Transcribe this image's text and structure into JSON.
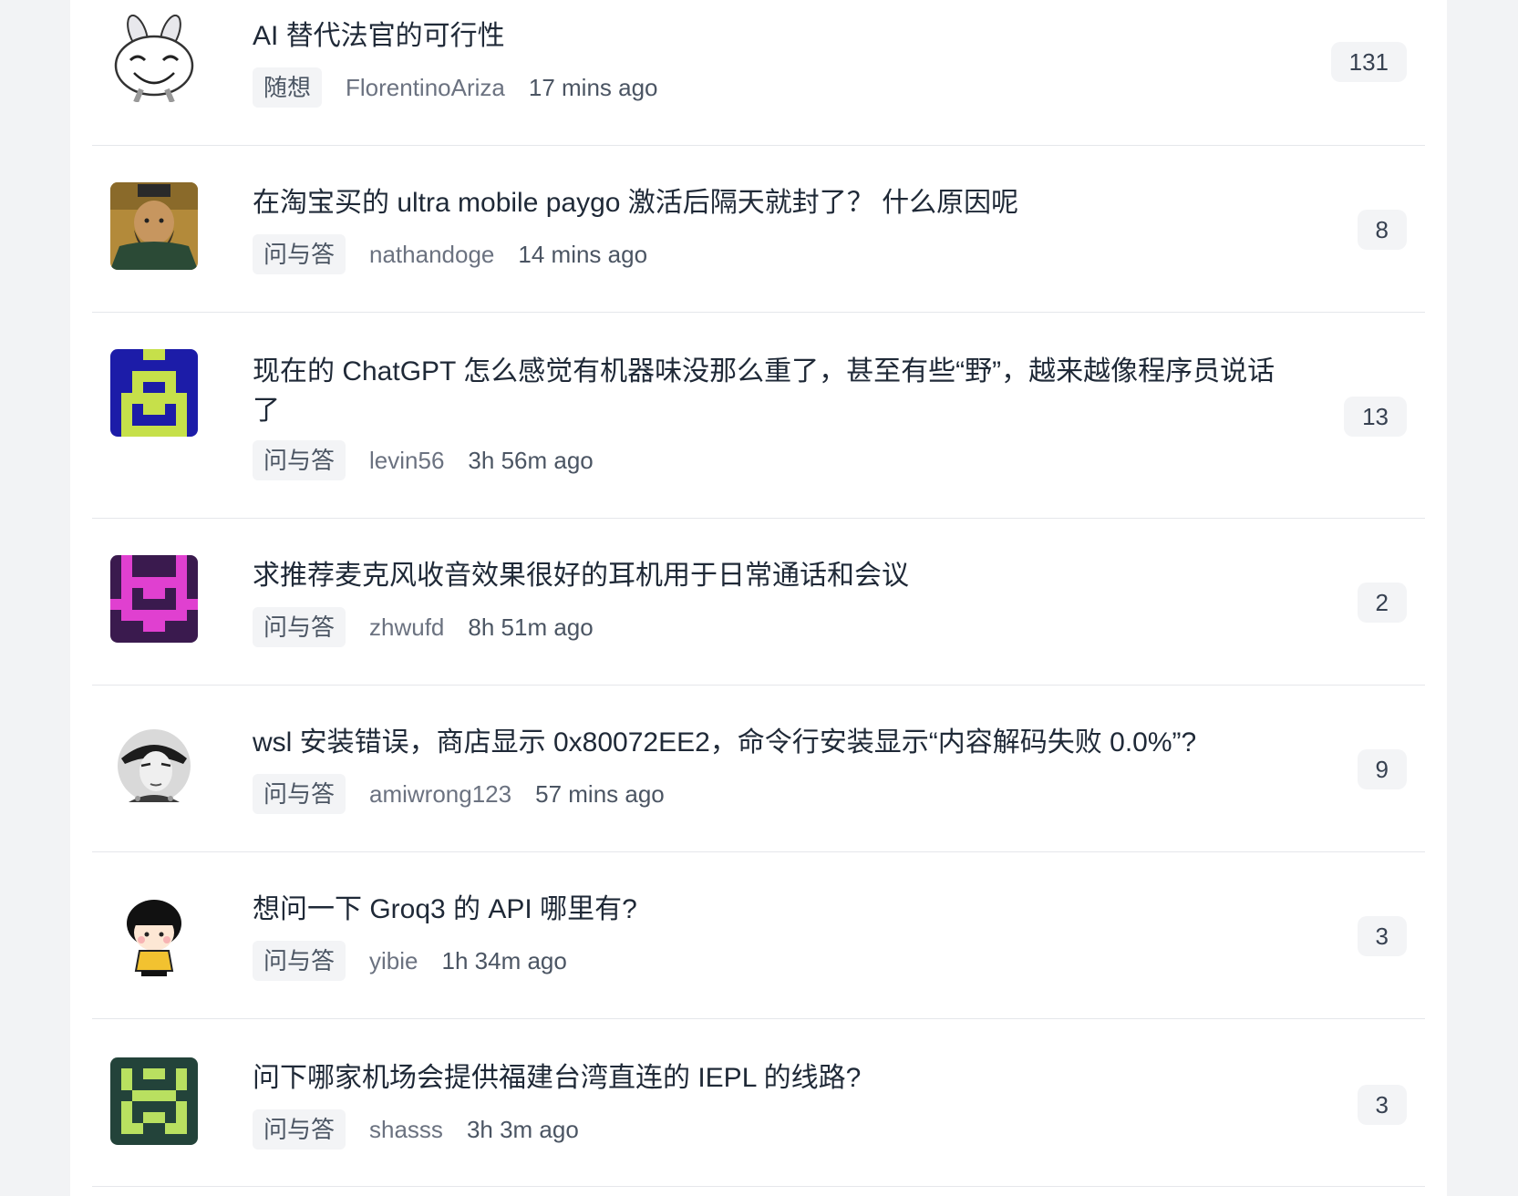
{
  "topics": [
    {
      "title": "AI 替代法官的可行性",
      "tag": "随想",
      "author": "FlorentinoAriza",
      "time": "17 mins ago",
      "replies": "131",
      "avatar": "cartoon-rabbit"
    },
    {
      "title": "在淘宝买的 ultra mobile paygo 激活后隔天就封了？ 什么原因呢",
      "tag": "问与答",
      "author": "nathandoge",
      "time": "14 mins ago",
      "replies": "8",
      "avatar": "portrait-painting"
    },
    {
      "title": "现在的 ChatGPT 怎么感觉有机器味没那么重了，甚至有些“野”，越来越像程序员说话了",
      "tag": "问与答",
      "author": "levin56",
      "time": "3h 56m ago",
      "replies": "13",
      "avatar": "pixel-blue-yellow"
    },
    {
      "title": "求推荐麦克风收音效果很好的耳机用于日常通话和会议",
      "tag": "问与答",
      "author": "zhwufd",
      "time": "8h 51m ago",
      "replies": "2",
      "avatar": "pixel-purple-pink"
    },
    {
      "title": "wsl 安装错误，商店显示 0x80072EE2，命令行安装显示“内容解码失败 0.0%”?",
      "tag": "问与答",
      "author": "amiwrong123",
      "time": "57 mins ago",
      "replies": "9",
      "avatar": "anime-character"
    },
    {
      "title": "想问一下 Groq3 的 API 哪里有?",
      "tag": "问与答",
      "author": "yibie",
      "time": "1h 34m ago",
      "replies": "3",
      "avatar": "cartoon-girl"
    },
    {
      "title": "问下哪家机场会提供福建台湾直连的 IEPL 的线路?",
      "tag": "问与答",
      "author": "shasss",
      "time": "3h 3m ago",
      "replies": "3",
      "avatar": "pixel-green"
    }
  ]
}
